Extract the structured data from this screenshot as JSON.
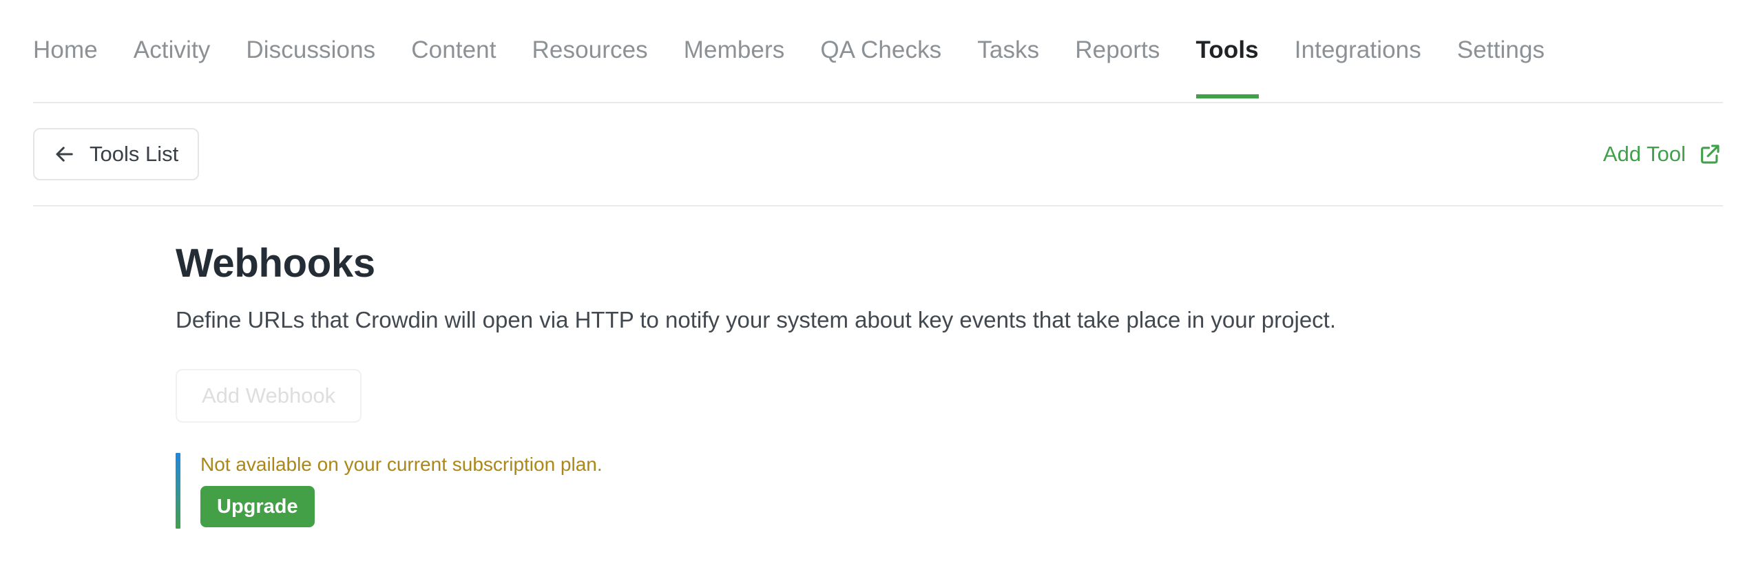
{
  "nav": {
    "tabs": [
      {
        "label": "Home",
        "active": false
      },
      {
        "label": "Activity",
        "active": false
      },
      {
        "label": "Discussions",
        "active": false
      },
      {
        "label": "Content",
        "active": false
      },
      {
        "label": "Resources",
        "active": false
      },
      {
        "label": "Members",
        "active": false
      },
      {
        "label": "QA Checks",
        "active": false
      },
      {
        "label": "Tasks",
        "active": false
      },
      {
        "label": "Reports",
        "active": false
      },
      {
        "label": "Tools",
        "active": true
      },
      {
        "label": "Integrations",
        "active": false
      },
      {
        "label": "Settings",
        "active": false
      }
    ],
    "active_tab": "Tools",
    "active_underline_color": "#41a04a",
    "inactive_color": "#8c9196",
    "active_color": "#1f2326"
  },
  "subbar": {
    "back_button": {
      "label": "Tools List",
      "icon": "arrow-left-icon"
    },
    "add_tool": {
      "label": "Add Tool",
      "icon": "external-link-icon",
      "color": "#41a04a"
    }
  },
  "main": {
    "title": "Webhooks",
    "description": "Define URLs that Crowdin will open via HTTP to notify your system about key events that take place in your project.",
    "add_webhook_button": {
      "label": "Add Webhook",
      "disabled": true,
      "text_color": "#dcdee0"
    },
    "notice": {
      "message": "Not available on your current subscription plan.",
      "message_color": "#ab8719",
      "accent_gradient_from": "#1e87dd",
      "accent_gradient_to": "#41a04a",
      "upgrade_button": {
        "label": "Upgrade",
        "background": "#43a047",
        "text_color": "#ffffff"
      }
    }
  }
}
